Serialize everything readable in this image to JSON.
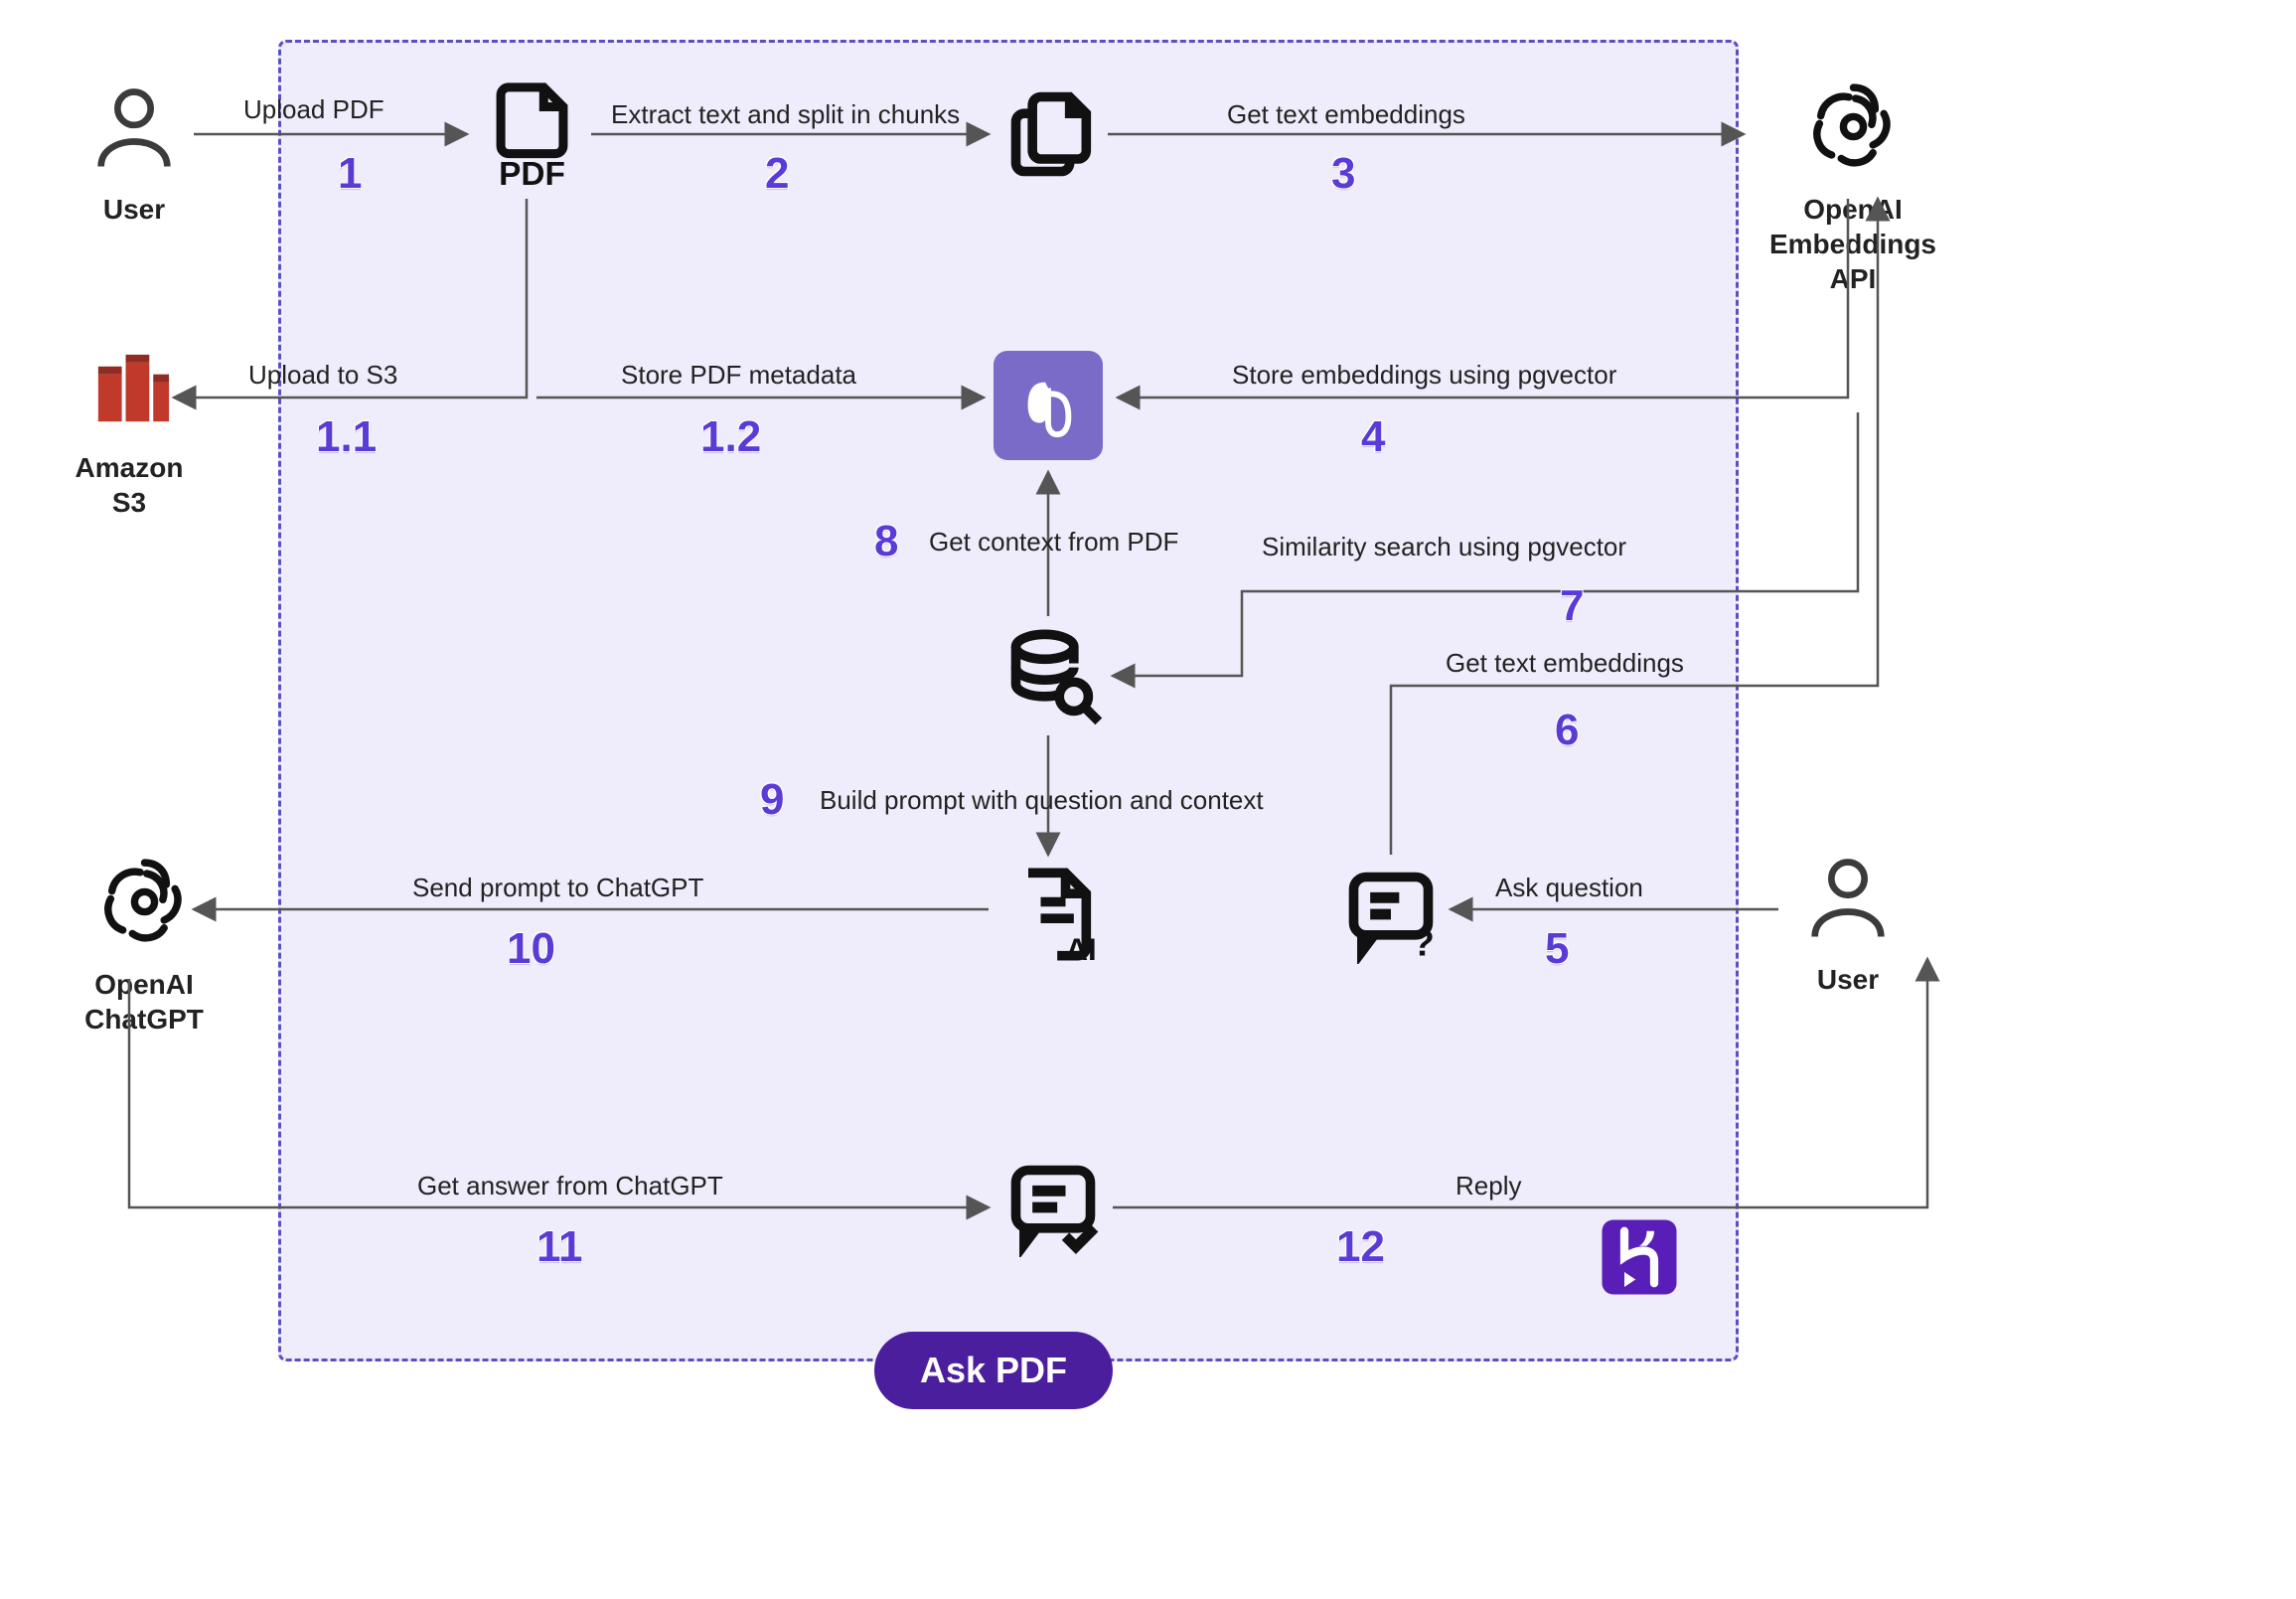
{
  "container": {
    "badge": "Ask PDF"
  },
  "nodes": {
    "user_top": {
      "label": "User"
    },
    "user_bottom": {
      "label": "User"
    },
    "s3": {
      "label": "Amazon\nS3"
    },
    "pdf": {
      "label": ""
    },
    "chunks": {
      "label": ""
    },
    "openai_embed": {
      "label": "OpenAI\nEmbeddings\nAPI"
    },
    "db": {
      "label": ""
    },
    "dbsearch": {
      "label": ""
    },
    "ai_prompt": {
      "label": ""
    },
    "question": {
      "label": ""
    },
    "openai_chatgpt": {
      "label": "OpenAI\nChatGPT"
    },
    "answer": {
      "label": ""
    },
    "heroku": {
      "label": ""
    }
  },
  "steps": {
    "s1": {
      "num": "1",
      "label": "Upload PDF"
    },
    "s1_1": {
      "num": "1.1",
      "label": "Upload to S3"
    },
    "s1_2": {
      "num": "1.2",
      "label": "Store PDF metadata"
    },
    "s2": {
      "num": "2",
      "label": "Extract text and split in chunks"
    },
    "s3": {
      "num": "3",
      "label": "Get text embeddings"
    },
    "s4": {
      "num": "4",
      "label": "Store embeddings using pgvector"
    },
    "s5": {
      "num": "5",
      "label": "Ask question"
    },
    "s6": {
      "num": "6",
      "label": "Get text embeddings"
    },
    "s7": {
      "num": "7",
      "label": "Similarity search using pgvector"
    },
    "s8": {
      "num": "8",
      "label": "Get context from PDF"
    },
    "s9": {
      "num": "9",
      "label": "Build prompt with question and context"
    },
    "s10": {
      "num": "10",
      "label": "Send prompt to ChatGPT"
    },
    "s11": {
      "num": "11",
      "label": "Get answer from ChatGPT"
    },
    "s12": {
      "num": "12",
      "label": "Reply"
    }
  }
}
